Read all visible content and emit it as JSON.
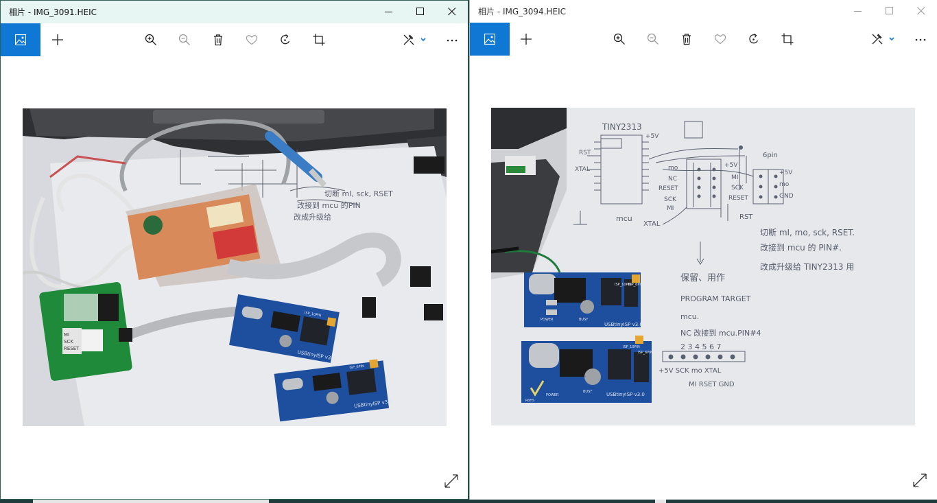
{
  "left_window": {
    "title": "相片 - IMG_3091.HEIC",
    "photo_label_usb": "USBtinyISP v3.0",
    "photo_label_isp10": "ISP_10PIN",
    "photo_label_isp6": "ISP_6PIN"
  },
  "right_window": {
    "title": "相片 - IMG_3094.HEIC",
    "sketch": {
      "chip_label": "TINY2313",
      "plus5v": "+5V",
      "rst": "RST",
      "xtal": "XTAL",
      "mcu": "mcu",
      "xtal2": "XTAL",
      "rst2": "RST",
      "pin_labels": [
        "mo",
        "NC",
        "RESET",
        "SCK",
        "MI"
      ],
      "plus5v_b": "+5V",
      "x_marks": [
        "MI",
        "SCK",
        "RESET"
      ],
      "six_pin": "6pin",
      "six_labels": [
        "+5V",
        "mo",
        "GND"
      ],
      "note_1": "切断 mI, mo, sck, RSET.",
      "note_2": "改接到 mcu 的 PIN#.",
      "note_3": "改成升级给 TINY2313 用",
      "note_4": "保留、用作",
      "note_5": "PROGRAM TARGET",
      "note_6": "mcu.",
      "note_7": "NC 改接到 mcu.PIN#4",
      "pin_numbers": "2 3 4 5 6 7",
      "pin_bottom_1": "+5V SCK  mo  XTAL",
      "pin_bottom_2": "MI  RSET  GND"
    },
    "board_label_usb": "USBtinyISP v3.0",
    "board_label_isp10": "ISP_10PIN",
    "board_label_isp6": "ISP_6PIN",
    "board_label_power": "POWER",
    "board_label_busy": "BUSY",
    "board_label_rohs": "RoHS"
  },
  "colors": {
    "accent": "#0f78d4",
    "board_blue": "#1d4f9e"
  },
  "icons": [
    "photo-icon",
    "add-icon",
    "zoom-in-icon",
    "zoom-out-icon",
    "delete-icon",
    "favorite-icon",
    "rotate-icon",
    "crop-icon",
    "edit-icon",
    "chevron-down-icon",
    "more-icon",
    "expand-icon",
    "minimize-icon",
    "maximize-icon",
    "close-icon"
  ]
}
